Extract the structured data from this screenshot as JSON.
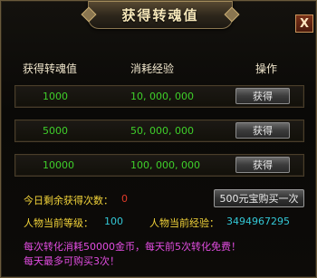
{
  "dialog": {
    "title": "获得转魂值",
    "close_label": "X"
  },
  "table": {
    "headers": [
      "获得转魂值",
      "消耗经验",
      "操作"
    ],
    "rows": [
      {
        "soul": "1000",
        "exp": "10, 000, 000",
        "button": "获得"
      },
      {
        "soul": "5000",
        "exp": "50, 000, 000",
        "button": "获得"
      },
      {
        "soul": "10000",
        "exp": "100, 000, 000",
        "button": "获得"
      }
    ]
  },
  "info": {
    "remaining_label": "今日剩余获得次数：",
    "remaining_value": "0",
    "buy_button": "500元宝购买一次",
    "level_label": "人物当前等级：",
    "level_value": "100",
    "exp_label": "人物当前经验：",
    "exp_value": "3494967295"
  },
  "notes": {
    "line1": "每次转化消耗50000金币，每天前5次转化免费！",
    "line2": "每天最多可购买3次！"
  },
  "colors": {
    "green": "#3fcf2a",
    "yellow": "#f2d33a",
    "cyan": "#33c7d6",
    "red": "#e23a2a",
    "magenta": "#e14ce0"
  }
}
